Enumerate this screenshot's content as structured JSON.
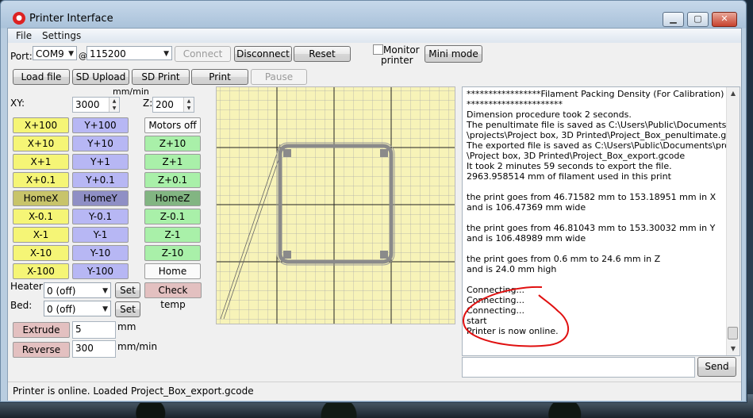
{
  "window": {
    "title": "Printer Interface",
    "icon_name": "printer-app-icon"
  },
  "menu": {
    "file": "File",
    "settings": "Settings"
  },
  "connection": {
    "port_label": "Port:",
    "port_value": "COM9",
    "at_label": "@",
    "baud_value": "115200",
    "connect": "Connect",
    "disconnect": "Disconnect",
    "reset": "Reset",
    "monitor_label_line1": "Monitor",
    "monitor_label_line2": "printer",
    "mini_mode": "Mini mode"
  },
  "toolbar": {
    "load_file": "Load file",
    "sd_upload": "SD Upload",
    "sd_print": "SD Print",
    "print": "Print",
    "pause": "Pause"
  },
  "feedrate": {
    "units": "mm/min",
    "xy_label": "XY:",
    "xy_value": "3000",
    "z_label": "Z:",
    "z_value": "200"
  },
  "jog": {
    "x": [
      "X+100",
      "X+10",
      "X+1",
      "X+0.1",
      "HomeX",
      "X-0.1",
      "X-1",
      "X-10",
      "X-100"
    ],
    "y": [
      "Y+100",
      "Y+10",
      "Y+1",
      "Y+0.1",
      "HomeY",
      "Y-0.1",
      "Y-1",
      "Y-10",
      "Y-100"
    ],
    "z": [
      "Motors off",
      "Z+10",
      "Z+1",
      "Z+0.1",
      "HomeZ",
      "Z-0.1",
      "Z-1",
      "Z-10",
      "Home"
    ]
  },
  "temps": {
    "heater_label": "Heater:",
    "heater_value": "0 (off)",
    "set": "Set",
    "check_temp": "Check temp",
    "bed_label": "Bed:",
    "bed_value": "0 (off)"
  },
  "extrude": {
    "extrude": "Extrude",
    "extrude_value": "5",
    "extrude_units": "mm",
    "reverse": "Reverse",
    "reverse_value": "300",
    "reverse_units": "mm/min"
  },
  "log": [
    "*****************Filament Packing Density (For Calibration)",
    "**********************",
    "Dimension procedure took 2 seconds.",
    "The penultimate file is saved as C:\\Users\\Public\\Documents",
    "\\projects\\Project box, 3D Printed\\Project_Box_penultimate.gcode",
    "The exported file is saved as C:\\Users\\Public\\Documents\\projects",
    "\\Project box, 3D Printed\\Project_Box_export.gcode",
    "It took 2 minutes 59 seconds to export the file.",
    "2963.958514 mm of filament used in this print",
    "",
    "the print goes from 46.71582 mm to 153.18951 mm in X",
    "and is 106.47369 mm wide",
    "",
    "the print goes from 46.81043 mm to 153.30032 mm in Y",
    "and is 106.48989 mm wide",
    "",
    "the print goes from 0.6 mm to 24.6 mm in Z",
    "and is 24.0 mm high",
    "",
    "Connecting...",
    "Connecting...",
    "Connecting...",
    "start",
    "Printer is now online."
  ],
  "send": "Send",
  "status": "Printer is online. Loaded Project_Box_export.gcode",
  "colors": {
    "x_button": "#f5f576",
    "y_button": "#b7b7f4",
    "z_button": "#a9f0a9",
    "annotation_circle": "#e01010"
  }
}
